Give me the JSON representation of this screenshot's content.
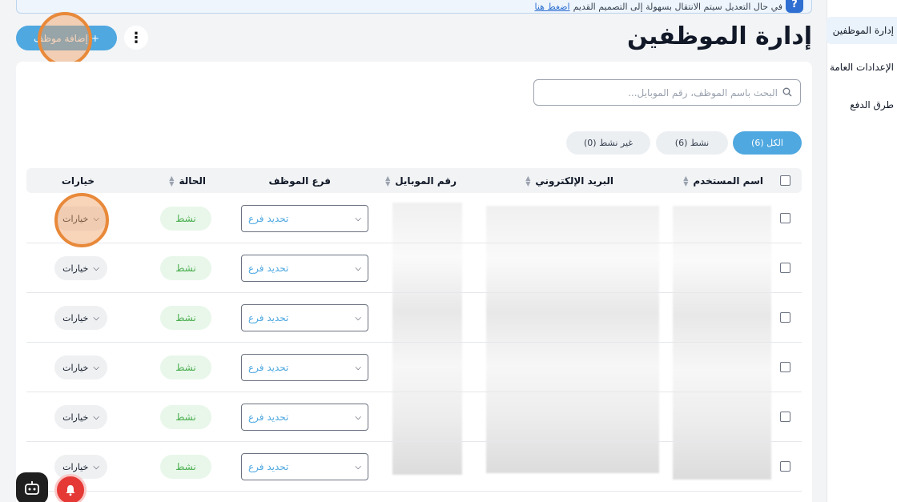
{
  "sidebar": {
    "items": [
      {
        "label": "إدارة الموظفين"
      },
      {
        "label": "الإعدادات العامة"
      },
      {
        "label": "طرق الدفع"
      }
    ]
  },
  "banner": {
    "text": "في حال التعديل سيتم الانتقال بسهولة إلى التصميم القديم",
    "link": "اضغط هنا"
  },
  "page": {
    "title": "إدارة الموظفين",
    "add_button": "إضافة موظف",
    "add_plus": "+",
    "kebab": "⋮"
  },
  "search": {
    "placeholder": "البحث باسم الموظف، رقم الموبايل...",
    "value": ""
  },
  "filters": [
    {
      "label": "الكل (6)",
      "active": true
    },
    {
      "label": "نشط (6)",
      "active": false
    },
    {
      "label": "غير نشط (0)",
      "active": false
    }
  ],
  "table": {
    "columns": {
      "username": "اسم المستخدم",
      "email": "البريد الإلكتروني",
      "mobile": "رقم الموبايل",
      "branch": "فرع الموظف",
      "status": "الحالة",
      "options": "خيارات"
    },
    "rows": [
      {
        "branch_placeholder": "تحديد فرع",
        "status": "نشط",
        "options": "خيارات"
      },
      {
        "branch_placeholder": "تحديد فرع",
        "status": "نشط",
        "options": "خيارات"
      },
      {
        "branch_placeholder": "تحديد فرع",
        "status": "نشط",
        "options": "خيارات"
      },
      {
        "branch_placeholder": "تحديد فرع",
        "status": "نشط",
        "options": "خيارات"
      },
      {
        "branch_placeholder": "تحديد فرع",
        "status": "نشط",
        "options": "خيارات"
      },
      {
        "branch_placeholder": "تحديد فرع",
        "status": "نشط",
        "options": "خيارات"
      }
    ]
  },
  "colors": {
    "accent": "#4fa8e0",
    "status_active_bg": "#e8f7ea",
    "status_active_text": "#4caf50",
    "highlight": "#e8893a"
  }
}
